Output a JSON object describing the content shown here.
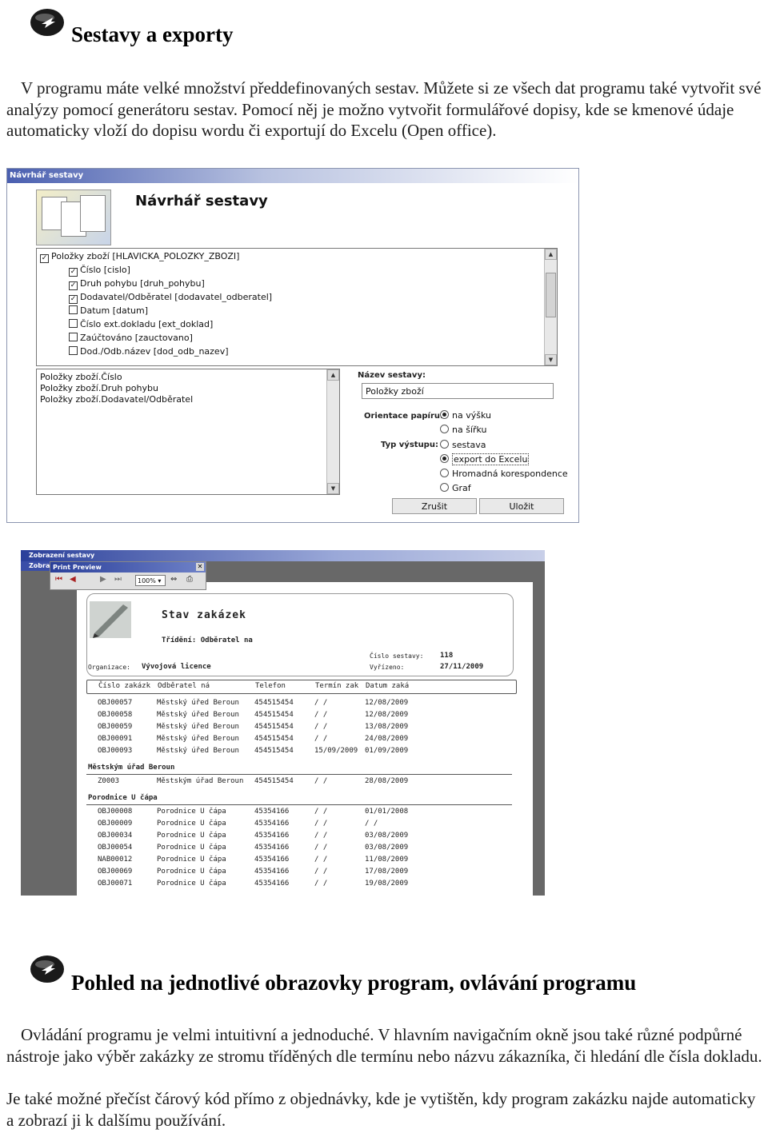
{
  "section1": {
    "heading": "Sestavy a exporty",
    "paragraph": "V programu máte velké množství předdefinovaných sestav. Můžete si ze všech dat programu také vytvořit své analýzy pomocí generátoru sestav. Pomocí něj je možno vytvořit formulářové dopisy, kde se kmenové údaje automaticky vloží do dopisu wordu či exportují do Excelu (Open office)."
  },
  "designer": {
    "window_title": "Návrhář sestavy",
    "big_title": "Návrhář sestavy",
    "tree_root": "Položky zboží [HLAVICKA_POLOZKY_ZBOZI]",
    "tree_items": [
      {
        "label": "Číslo [cislo]",
        "checked": true
      },
      {
        "label": "Druh pohybu [druh_pohybu]",
        "checked": true
      },
      {
        "label": "Dodavatel/Odběratel [dodavatel_odberatel]",
        "checked": true
      },
      {
        "label": "Datum [datum]",
        "checked": false
      },
      {
        "label": "Číslo ext.dokladu [ext_doklad]",
        "checked": false
      },
      {
        "label": "Zaúčtováno [zauctovano]",
        "checked": false
      },
      {
        "label": "Dod./Odb.název [dod_odb_nazev]",
        "checked": false
      }
    ],
    "selected_fields": [
      "Položky zboží.Číslo",
      "Položky zboží.Druh pohybu",
      "Položky zboží.Dodavatel/Odběratel"
    ],
    "name_label": "Název sestavy:",
    "name_value": "Položky zboží",
    "orientation_label": "Orientace papíru:",
    "orientation_options": [
      {
        "label": "na výšku",
        "selected": true
      },
      {
        "label": "na šířku",
        "selected": false
      }
    ],
    "output_label": "Typ výstupu:",
    "output_options": [
      {
        "label": "sestava",
        "selected": false
      },
      {
        "label": "export do Excelu",
        "selected": true
      },
      {
        "label": "Hromadná korespondence",
        "selected": false
      },
      {
        "label": "Graf",
        "selected": false
      }
    ],
    "cancel_button": "Zrušit",
    "save_button": "Uložit"
  },
  "preview": {
    "outer_title": "Zobrazení sestavy",
    "inner_tab": "Zobra",
    "pp_title": "Print Preview",
    "zoom": "100%",
    "report_title": "Stav zakázek",
    "sort_label": "Třídění: Odběratel na",
    "org_label": "Organizace:",
    "org_value": "Vývojová licence",
    "num_label": "Číslo sestavy:",
    "num_value": "118",
    "date_label": "Vyřízeno:",
    "date_value": "27/11/2009",
    "columns": [
      "Číslo zakázk",
      "Odběratel ná",
      "Telefon",
      "Termín zak",
      "Datum zaká"
    ],
    "group1_rows": [
      [
        "OBJ00057",
        "Městský úřed Beroun",
        "454515454",
        " /  /",
        "12/08/2009"
      ],
      [
        "OBJ00058",
        "Městský úřed Beroun",
        "454515454",
        " /  /",
        "12/08/2009"
      ],
      [
        "OBJ00059",
        "Městský úřed Beroun",
        "454515454",
        " /  /",
        "13/08/2009"
      ],
      [
        "OBJ00091",
        "Městský úřed Beroun",
        "454515454",
        " /  /",
        "24/08/2009"
      ],
      [
        "OBJ00093",
        "Městský úřed Beroun",
        "454515454",
        "15/09/2009",
        "01/09/2009"
      ]
    ],
    "group2_name": "Městským úřad Beroun",
    "group2_rows": [
      [
        "Z0003",
        "Městským úřad Beroun",
        "454515454",
        " /  /",
        "28/08/2009"
      ]
    ],
    "group3_name": "Porodnice U čápa",
    "group3_rows": [
      [
        "OBJ00008",
        "Porodnice U čápa",
        "45354166",
        " /  /",
        "01/01/2008"
      ],
      [
        "OBJ00009",
        "Porodnice U čápa",
        "45354166",
        " /  /",
        " /  /"
      ],
      [
        "OBJ00034",
        "Porodnice U čápa",
        "45354166",
        " /  /",
        "03/08/2009"
      ],
      [
        "OBJ00054",
        "Porodnice U čápa",
        "45354166",
        " /  /",
        "03/08/2009"
      ],
      [
        "NAB00012",
        "Porodnice U čápa",
        "45354166",
        " /  /",
        "11/08/2009"
      ],
      [
        "OBJ00069",
        "Porodnice U čápa",
        "45354166",
        " /  /",
        "17/08/2009"
      ],
      [
        "OBJ00071",
        "Porodnice U čápa",
        "45354166",
        " /  /",
        "19/08/2009"
      ]
    ]
  },
  "section2": {
    "heading": "Pohled na jednotlivé obrazovky program, ovlávání programu",
    "paragraph1": "Ovládání programu je velmi intuitivní a jednoduché. V hlavním navigačním okně jsou také různé podpůrné nástroje jako výběr zakázky ze stromu tříděných dle termínu nebo názvu zákazníka, či hledání dle čísla dokladu.",
    "paragraph2": "Je také možné přečíst čárový kód přímo z objednávky, kde je vytištěn, kdy program zakázku najde automaticky a zobrazí ji k dalšímu používání."
  }
}
